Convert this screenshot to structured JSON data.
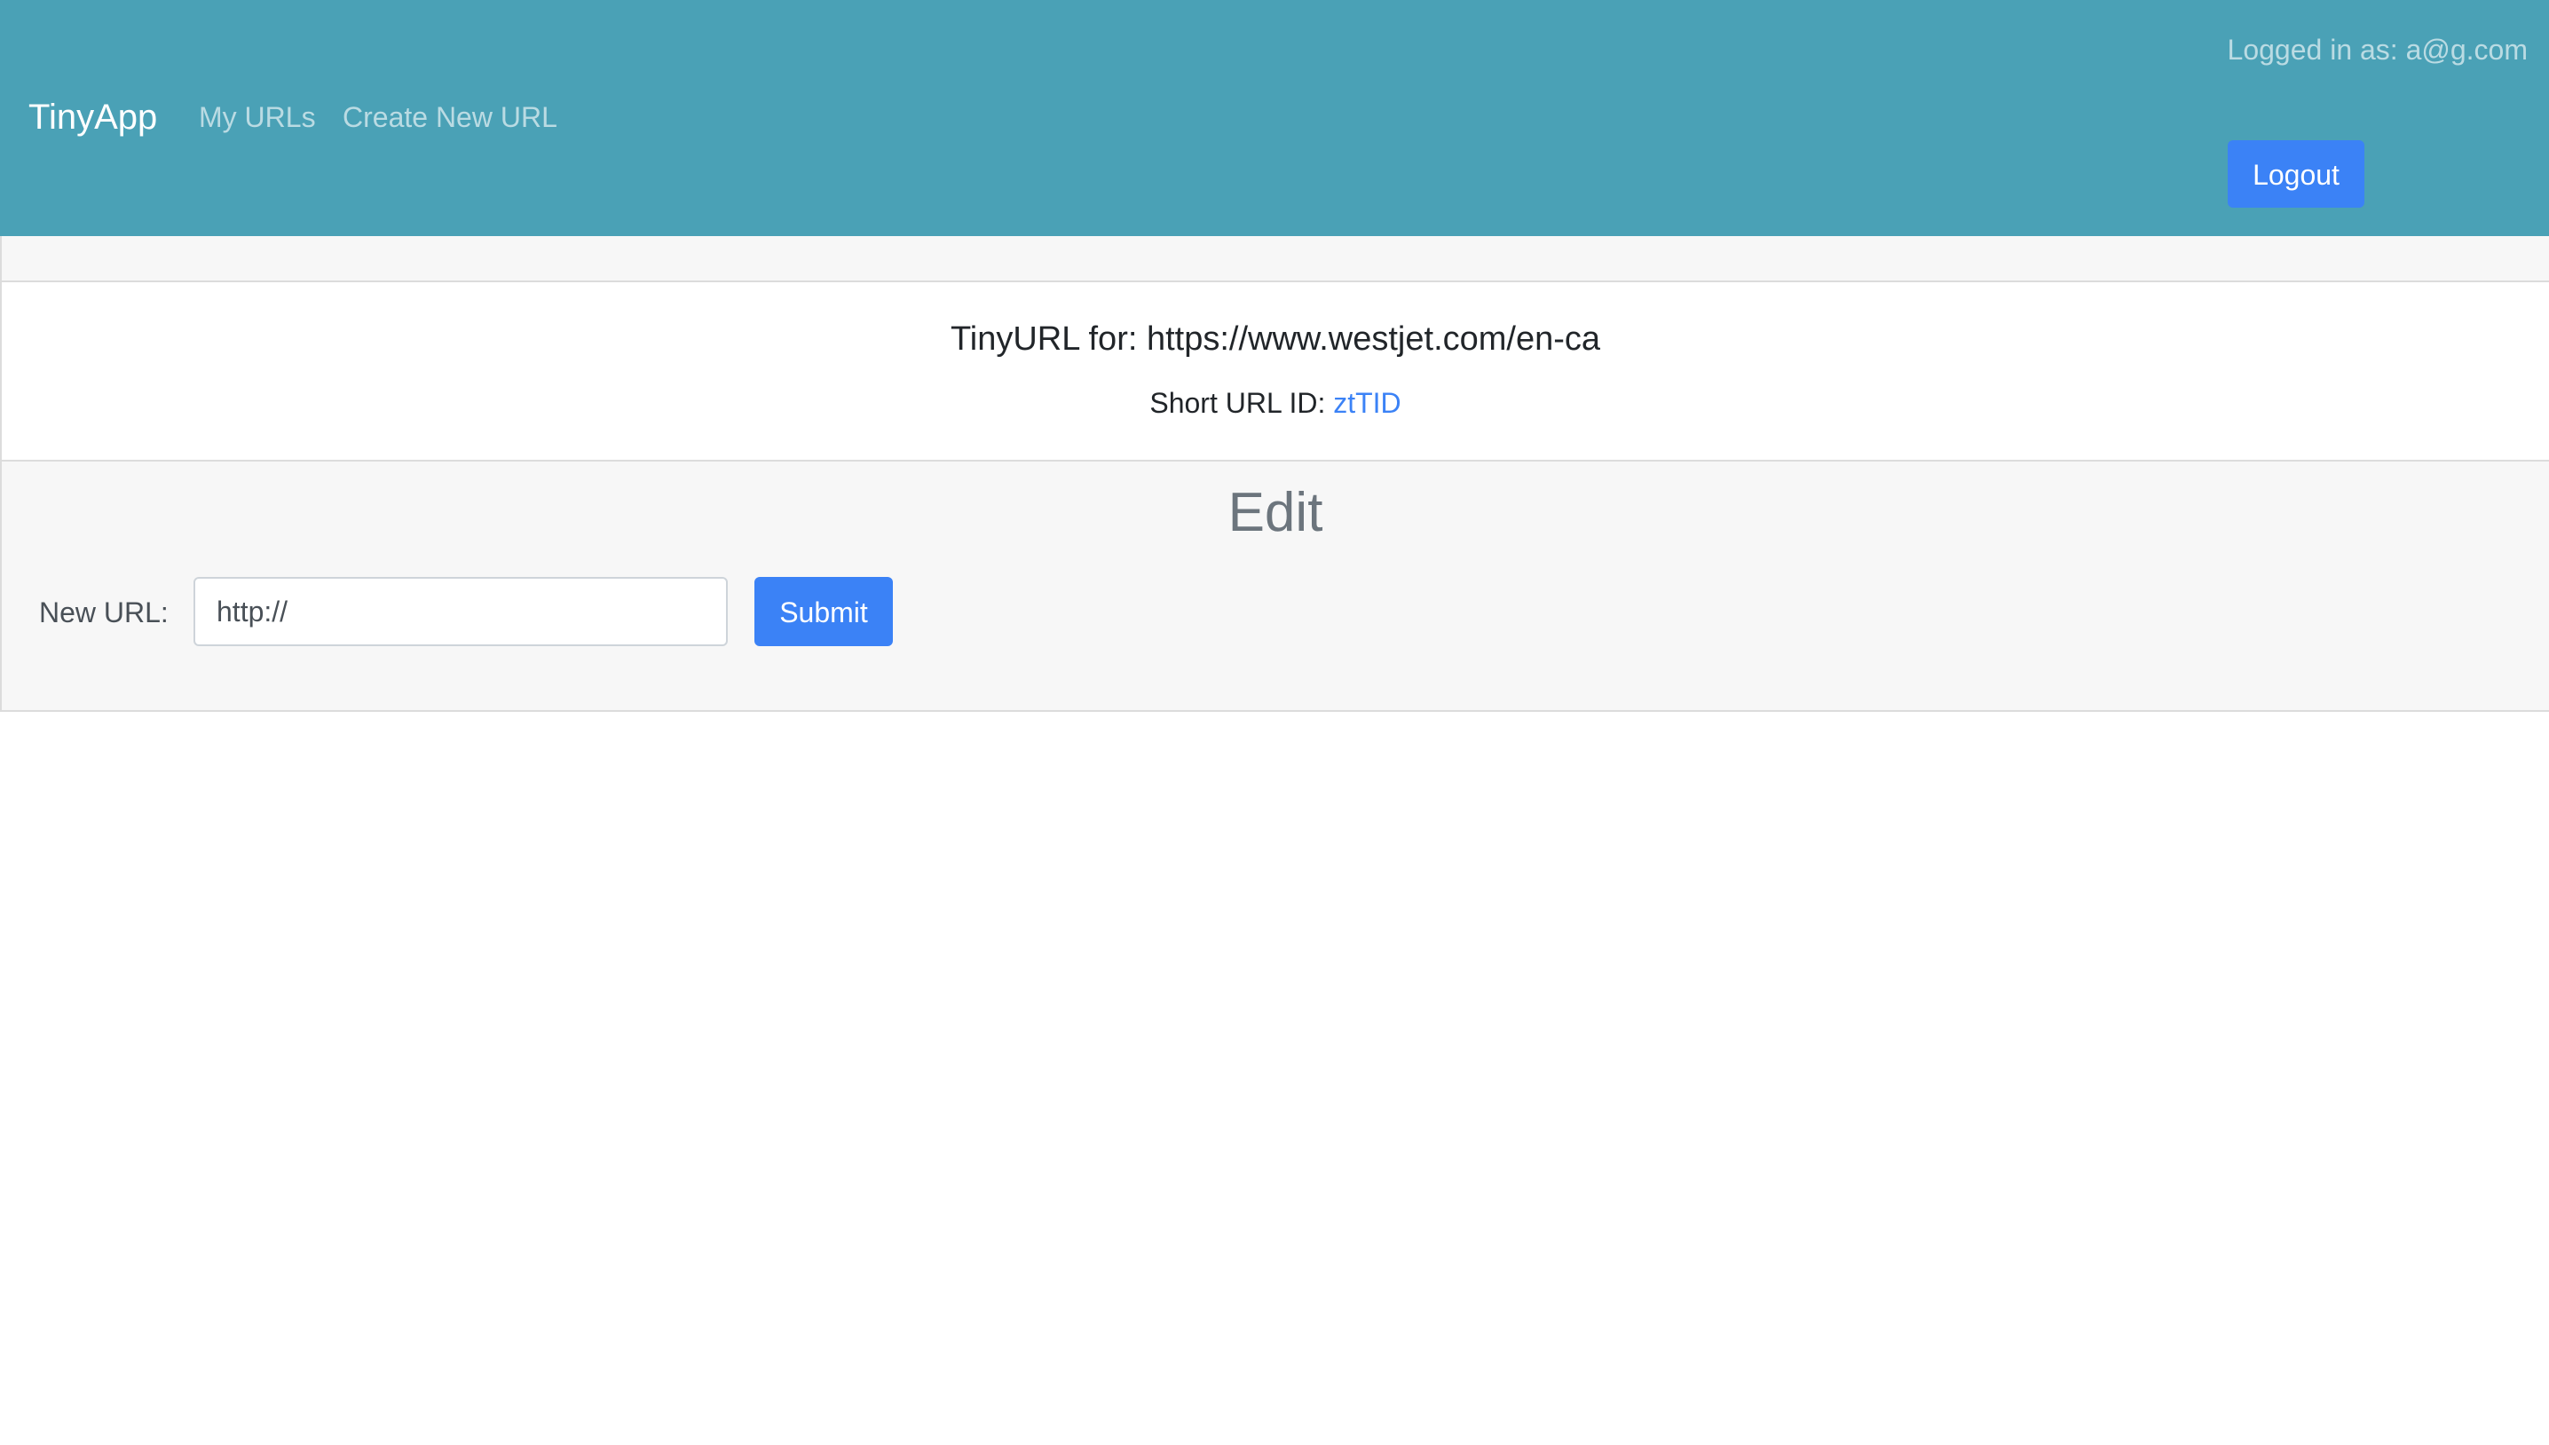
{
  "navbar": {
    "brand": "TinyApp",
    "links": [
      {
        "label": "My URLs"
      },
      {
        "label": "Create New URL"
      }
    ],
    "logged_in_text": "Logged in as: a@g.com",
    "logout_label": "Logout"
  },
  "url_card": {
    "title": "TinyURL for: https://www.westjet.com/en-ca",
    "short_id_label": "Short URL ID: ",
    "short_id": "ztTID"
  },
  "edit": {
    "heading": "Edit",
    "label": "New URL:",
    "input_value": "http://",
    "submit_label": "Submit"
  },
  "colors": {
    "navbar_bg": "#4aa1b6",
    "primary": "#3b82f6"
  }
}
